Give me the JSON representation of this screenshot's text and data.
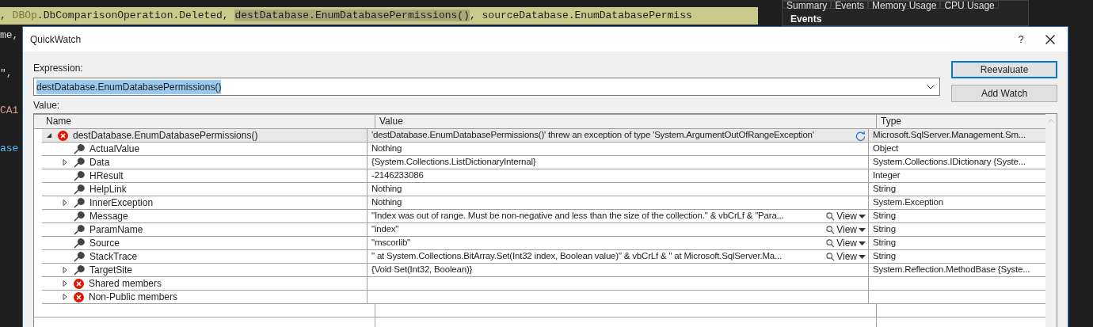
{
  "editor": {
    "code_line": [
      {
        "text": ", ",
        "kind": "plain"
      },
      {
        "text": "DBOp",
        "kind": "type"
      },
      {
        "text": ".DbComparisonOperation.Deleted, ",
        "kind": "plain"
      },
      {
        "text": "destDatabase.EnumDatabasePermissions()",
        "kind": "match"
      },
      {
        "text": ", sourceDatabase.EnumDatabasePermiss",
        "kind": "plain"
      }
    ],
    "fragments": [
      {
        "text": "me,",
        "kind": "plain"
      },
      {
        "text": "\",",
        "kind": "plain"
      },
      {
        "text": "CA1",
        "kind": "string"
      },
      {
        "text": "ase",
        "kind": "keyword"
      }
    ]
  },
  "side_panel": {
    "tabs": [
      "Summary",
      "Events",
      "Memory Usage",
      "CPU Usage"
    ],
    "heading": "Events"
  },
  "dialog": {
    "title": "QuickWatch",
    "help": "?",
    "expression_label": "Expression:",
    "expression": "destDatabase.EnumDatabasePermissions()",
    "buttons": [
      "Reevaluate",
      "Add Watch"
    ],
    "value_label": "Value:",
    "columns": [
      "Name",
      "Value",
      "Type"
    ],
    "rows": [
      {
        "name": "destDatabase.EnumDatabasePermissions()",
        "value": "'destDatabase.EnumDatabasePermissions()' threw an exception of type 'System.ArgumentOutOfRangeException'",
        "type": "Microsoft.SqlServer.Management.Sm...",
        "kind": "error",
        "expanded": true,
        "selected": true,
        "refresh": true,
        "children": [
          {
            "name": "ActualValue",
            "value": "Nothing",
            "type": "Object",
            "kind": "property",
            "selected": false
          },
          {
            "name": "Data",
            "value": "{System.Collections.ListDictionaryInternal}",
            "type": "System.Collections.IDictionary {Syste...",
            "kind": "property",
            "expanded": false,
            "selected": false
          },
          {
            "name": "HResult",
            "value": "-2146233086",
            "type": "Integer",
            "kind": "property",
            "selected": false
          },
          {
            "name": "HelpLink",
            "value": "Nothing",
            "type": "String",
            "kind": "property",
            "selected": false
          },
          {
            "name": "InnerException",
            "value": "Nothing",
            "type": "System.Exception",
            "kind": "property",
            "expanded": false,
            "selected": false
          },
          {
            "name": "Message",
            "value": "\"Index was out of range. Must be non-negative and less than the size of the collection.\" & vbCrLf & \"Para...",
            "type": "String",
            "kind": "property",
            "selected": false,
            "view": "View"
          },
          {
            "name": "ParamName",
            "value": "\"index\"",
            "type": "String",
            "kind": "property",
            "selected": false,
            "view": "View"
          },
          {
            "name": "Source",
            "value": "\"mscorlib\"",
            "type": "String",
            "kind": "property",
            "selected": false,
            "view": "View"
          },
          {
            "name": "StackTrace",
            "value": "\"   at System.Collections.BitArray.Set(Int32 index, Boolean value)\" & vbCrLf & \"   at Microsoft.SqlServer.Ma...",
            "type": "String",
            "kind": "property",
            "selected": false,
            "view": "View"
          },
          {
            "name": "TargetSite",
            "value": "{Void Set(Int32, Boolean)}",
            "type": "System.Reflection.MethodBase {Syste...",
            "kind": "property",
            "expanded": false,
            "selected": false
          },
          {
            "name": "Shared members",
            "kind": "error",
            "expanded": false,
            "selected": false
          },
          {
            "name": "Non-Public members",
            "kind": "error",
            "expanded": false,
            "selected": false
          }
        ]
      }
    ]
  }
}
